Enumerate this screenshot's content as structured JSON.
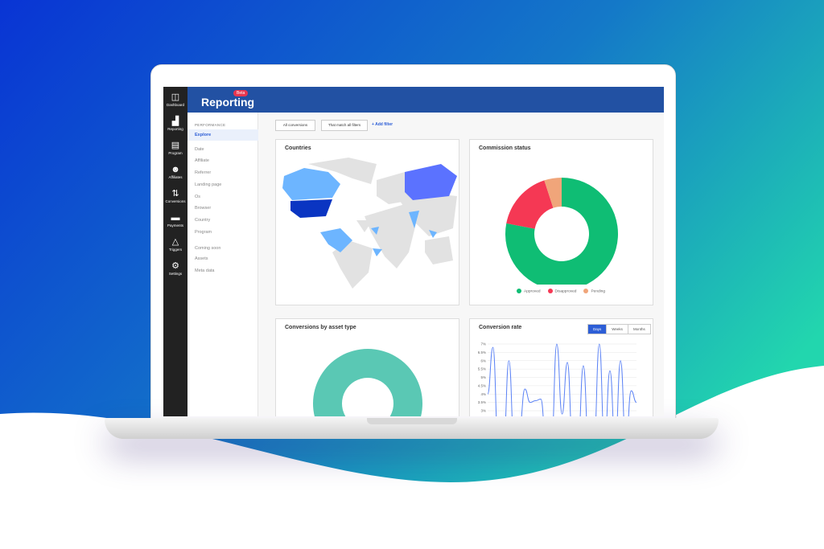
{
  "colors": {
    "header": "#2251a3",
    "accent": "#2d5ed6",
    "approved": "#0fbd74",
    "disapproved": "#f53854",
    "pending": "#f0a57a",
    "asset": "#5ac8b4",
    "line": "#5b82f5"
  },
  "sidebar": {
    "items": [
      {
        "icon": "dashboard-icon",
        "glyph": "◫",
        "label": "Dashboard"
      },
      {
        "icon": "reporting-icon",
        "glyph": "▟",
        "label": "Reporting"
      },
      {
        "icon": "program-icon",
        "glyph": "▤",
        "label": "Program"
      },
      {
        "icon": "affiliates-icon",
        "glyph": "☻",
        "label": "Affiliates"
      },
      {
        "icon": "conversions-icon",
        "glyph": "⇅",
        "label": "Conversions"
      },
      {
        "icon": "payments-icon",
        "glyph": "▬",
        "label": "Payments"
      },
      {
        "icon": "triggers-icon",
        "glyph": "△",
        "label": "Triggers"
      },
      {
        "icon": "settings-icon",
        "glyph": "⚙",
        "label": "Settings"
      }
    ]
  },
  "header": {
    "title": "Reporting",
    "badge": "Beta"
  },
  "subnav": {
    "section": "PERFORMANCE",
    "items": [
      "Explore",
      "Date",
      "Affiliate",
      "Referrer",
      "Landing page",
      "Os",
      "Browser",
      "Country",
      "Program"
    ],
    "coming_soon": "Coming soon",
    "soon_items": [
      "Assets",
      "Meta data"
    ]
  },
  "filters": {
    "conversions": "All conversions",
    "match": "That match all filters",
    "add": "+ Add filter"
  },
  "countries": {
    "title": "Countries"
  },
  "commission": {
    "title": "Commission status"
  },
  "assets": {
    "title": "Conversions by asset type"
  },
  "rate": {
    "title": "Conversion rate",
    "tabs": [
      "Days",
      "Weeks",
      "Months"
    ],
    "active": "Days"
  },
  "chart_data": [
    {
      "type": "pie",
      "title": "Commission status",
      "donut": true,
      "categories": [
        "Approved",
        "Disapproved",
        "Pending"
      ],
      "values": [
        78,
        17,
        5
      ],
      "legend": "bottom"
    },
    {
      "type": "pie",
      "title": "Conversions by asset type",
      "donut": true,
      "categories": [
        ""
      ],
      "values": [
        100
      ]
    },
    {
      "type": "line",
      "title": "Conversion rate",
      "ylim": [
        3,
        7
      ],
      "yticks": [
        "7%",
        "6.5%",
        "6%",
        "5.5%",
        "5%",
        "4.5%",
        "4%",
        "3.5%",
        "3%"
      ],
      "grid": true,
      "values": [
        4,
        6.8,
        1,
        1,
        6,
        1,
        2,
        4.3,
        3.5,
        3.6,
        3.7,
        1,
        1,
        7,
        2.8,
        5.9,
        1,
        1,
        5.7,
        1,
        1,
        7,
        1,
        5.4,
        1,
        6,
        1,
        4.2,
        3.5
      ]
    }
  ]
}
